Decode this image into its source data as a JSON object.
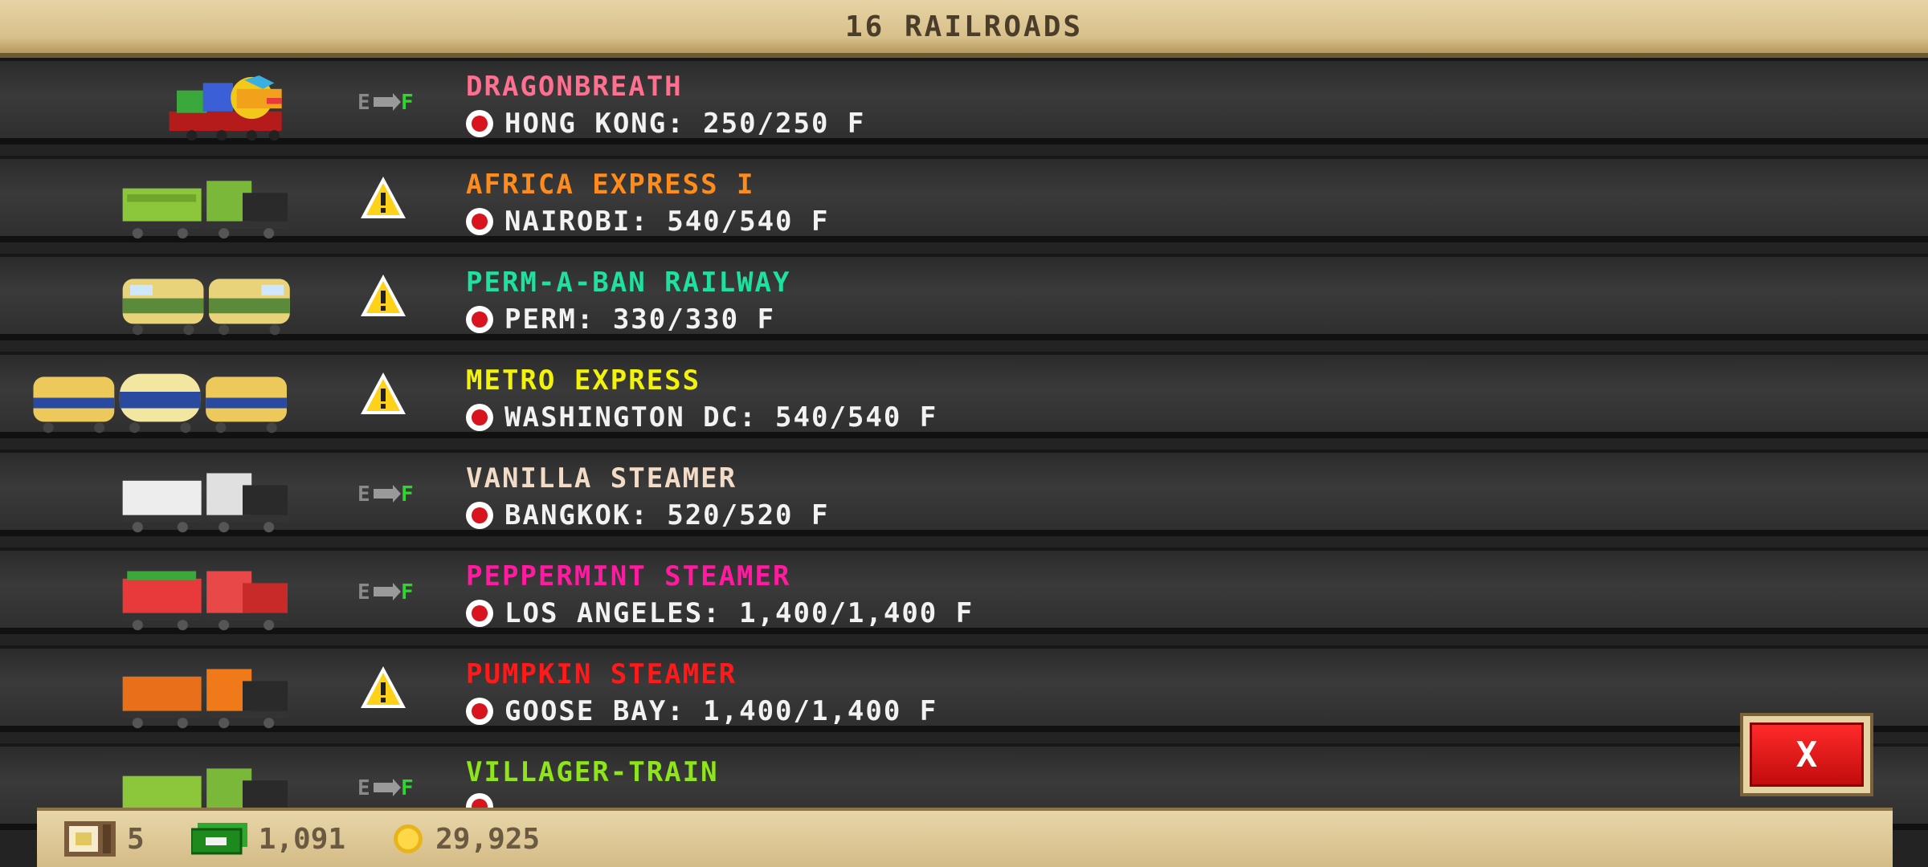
{
  "header": {
    "title": "16 RAILROADS"
  },
  "trains": [
    {
      "name": "DRAGONBREATH",
      "name_color": "#ff6f8f",
      "destination": "HONG KONG: 250/250 F",
      "status": "fuel-full"
    },
    {
      "name": "AFRICA EXPRESS I",
      "name_color": "#ff8c1a",
      "destination": "NAIROBI: 540/540 F",
      "status": "warning"
    },
    {
      "name": "PERM-A-BAN RAILWAY",
      "name_color": "#1ee0a0",
      "destination": "PERM: 330/330 F",
      "status": "warning"
    },
    {
      "name": "METRO EXPRESS",
      "name_color": "#f2f20a",
      "destination": "WASHINGTON DC: 540/540 F",
      "status": "warning"
    },
    {
      "name": "VANILLA STEAMER",
      "name_color": "#f2dcc8",
      "destination": "BANGKOK: 520/520 F",
      "status": "fuel-full"
    },
    {
      "name": "PEPPERMINT STEAMER",
      "name_color": "#ff1aa0",
      "destination": "LOS ANGELES: 1,400/1,400 F",
      "status": "fuel-full"
    },
    {
      "name": "PUMPKIN STEAMER",
      "name_color": "#ff1a1a",
      "destination": "GOOSE BAY: 1,400/1,400 F",
      "status": "warning"
    },
    {
      "name": "VILLAGER-TRAIN",
      "name_color": "#8ee61a",
      "destination": "",
      "status": "fuel-full"
    }
  ],
  "fuel_gauge": {
    "empty": "E",
    "full": "F"
  },
  "footer": {
    "items_count": "5",
    "cash": "1,091",
    "coins": "29,925"
  },
  "close_button": {
    "label": "X"
  },
  "colors": {
    "warning": "#ffd21a",
    "fuel_full": "#2fd62f",
    "close": "#e01616"
  }
}
